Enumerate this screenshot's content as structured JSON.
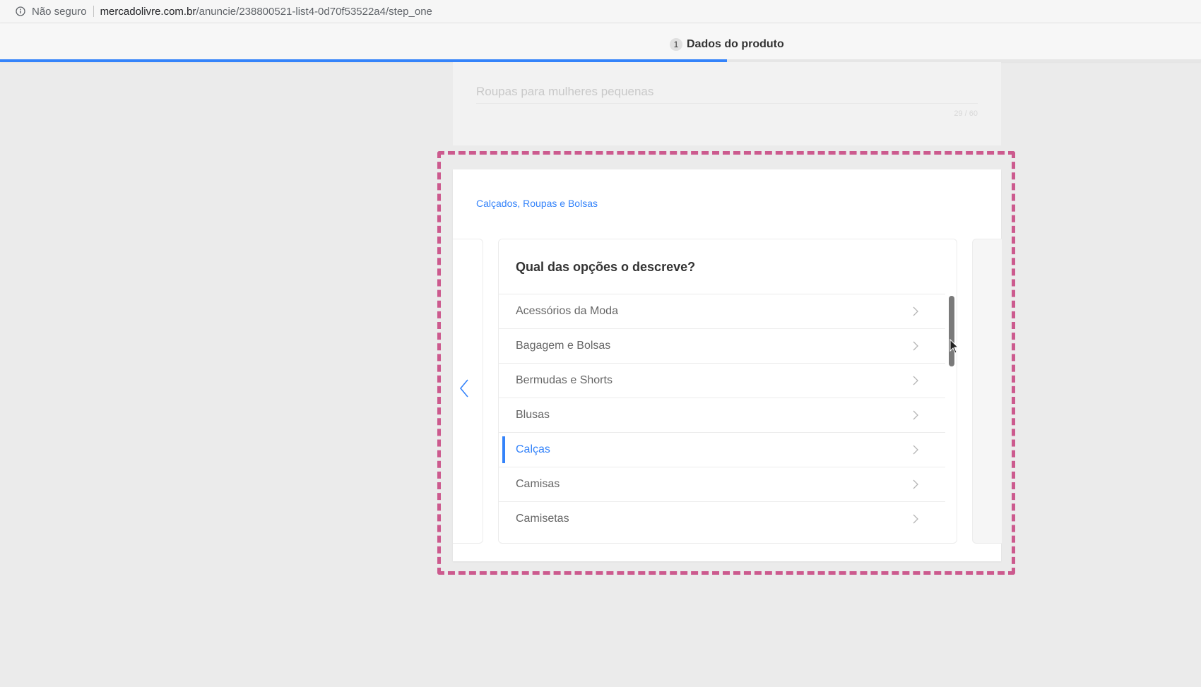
{
  "browser": {
    "security_text": "Não seguro",
    "url_host": "mercadolivre.com.br",
    "url_path": "/anuncie/238800521-list4-0d70f53522a4/step_one"
  },
  "steps": {
    "current_number": "1",
    "current_label": "Dados do produto",
    "progress_percent": 60.5
  },
  "previous_field": {
    "value": "Roupas para mulheres pequenas",
    "char_count": "29 / 60"
  },
  "category": {
    "breadcrumb": "Calçados, Roupas e Bolsas",
    "question": "Qual das opções o descreve?",
    "options": [
      "Acessórios da Moda",
      "Bagagem e Bolsas",
      "Bermudas e Shorts",
      "Blusas",
      "Calças",
      "Camisas",
      "Camisetas"
    ],
    "selected_option": "Calças"
  },
  "colors": {
    "accent": "#3483fa",
    "highlight_frame": "#cc5a8e",
    "background": "#ebebeb"
  }
}
